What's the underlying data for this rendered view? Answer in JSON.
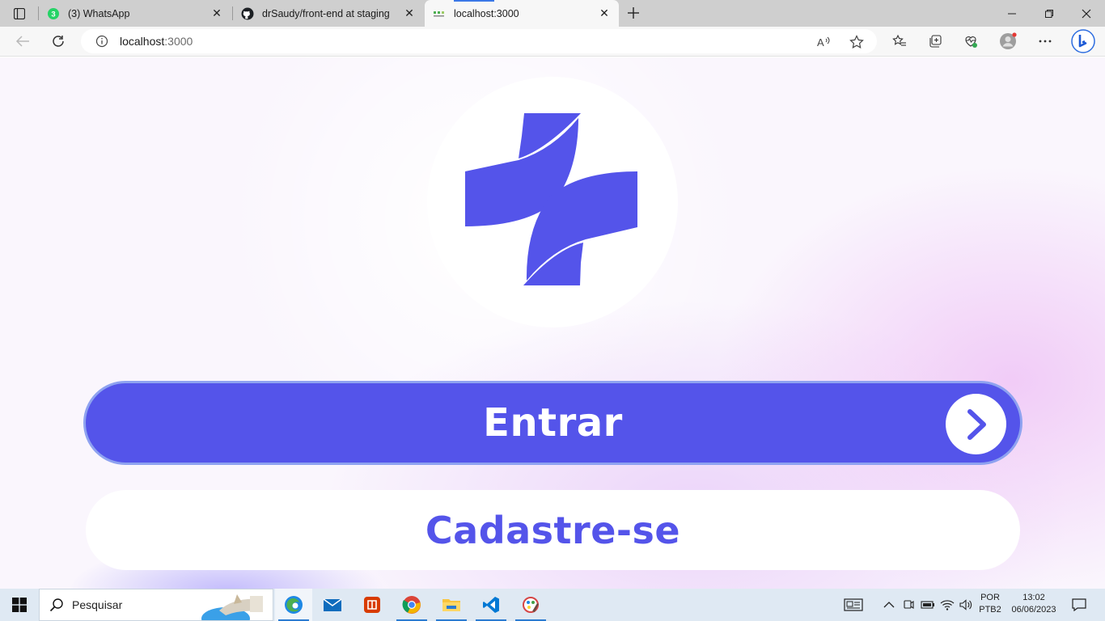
{
  "browser": {
    "tabs": [
      {
        "title": "(3) WhatsApp",
        "badge": "3",
        "icon": "whatsapp-icon"
      },
      {
        "title": "drSaudy/front-end at staging",
        "icon": "github-icon"
      },
      {
        "title": "localhost:3000",
        "icon": "localhost-favicon",
        "active": true
      }
    ],
    "address": {
      "host": "localhost",
      "port": ":3000"
    }
  },
  "page": {
    "logo": {
      "icon": "medical-cross-logo",
      "color": "#5454ea"
    },
    "enter_button": {
      "label": "Entrar",
      "icon": "chevron-right-icon"
    },
    "signup_button": {
      "label": "Cadastre-se"
    },
    "colors": {
      "primary": "#5454ea",
      "white": "#ffffff",
      "border": "#8ea2f0"
    }
  },
  "taskbar": {
    "search_placeholder": "Pesquisar",
    "apps": [
      "edge-icon",
      "mail-icon",
      "office-icon",
      "chrome-icon",
      "file-explorer-icon",
      "vscode-icon",
      "paint-icon"
    ],
    "language_top": "POR",
    "language_bottom": "PTB2",
    "time": "13:02",
    "date": "06/06/2023"
  }
}
